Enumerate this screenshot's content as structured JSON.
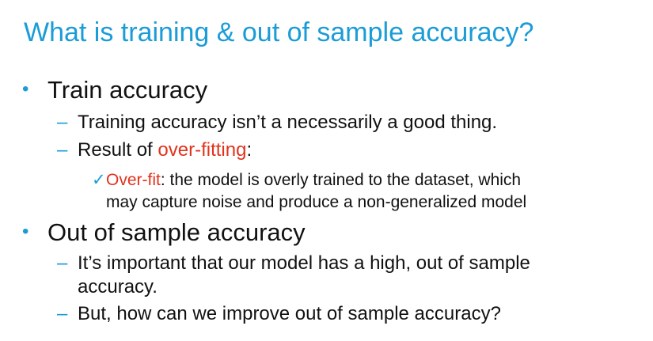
{
  "title": "What is training & out of sample accuracy?",
  "colors": {
    "title": "#1a9cd7",
    "bullet": "#1a9cd7",
    "highlight": "#e2321d",
    "text": "#111111"
  },
  "sections": [
    {
      "heading": "Train accuracy",
      "items": [
        "Training accuracy isn’t a necessarily a good thing.",
        {
          "prefix": "Result of ",
          "highlight": "over-fitting",
          "suffix": ":"
        }
      ],
      "subitem": {
        "highlight": "Over-fit",
        "line1_rest": ": the model is overly trained to the dataset, which",
        "line2": "may capture noise and produce a non-generalized model"
      }
    },
    {
      "heading": "Out of sample accuracy",
      "items": [
        {
          "line1": "It’s important that our model has a high, out of sample",
          "line2": "accuracy."
        },
        "But, how can we improve out of sample accuracy?"
      ]
    }
  ],
  "glyphs": {
    "bullet": "•",
    "dash": "–",
    "check": "✓"
  }
}
